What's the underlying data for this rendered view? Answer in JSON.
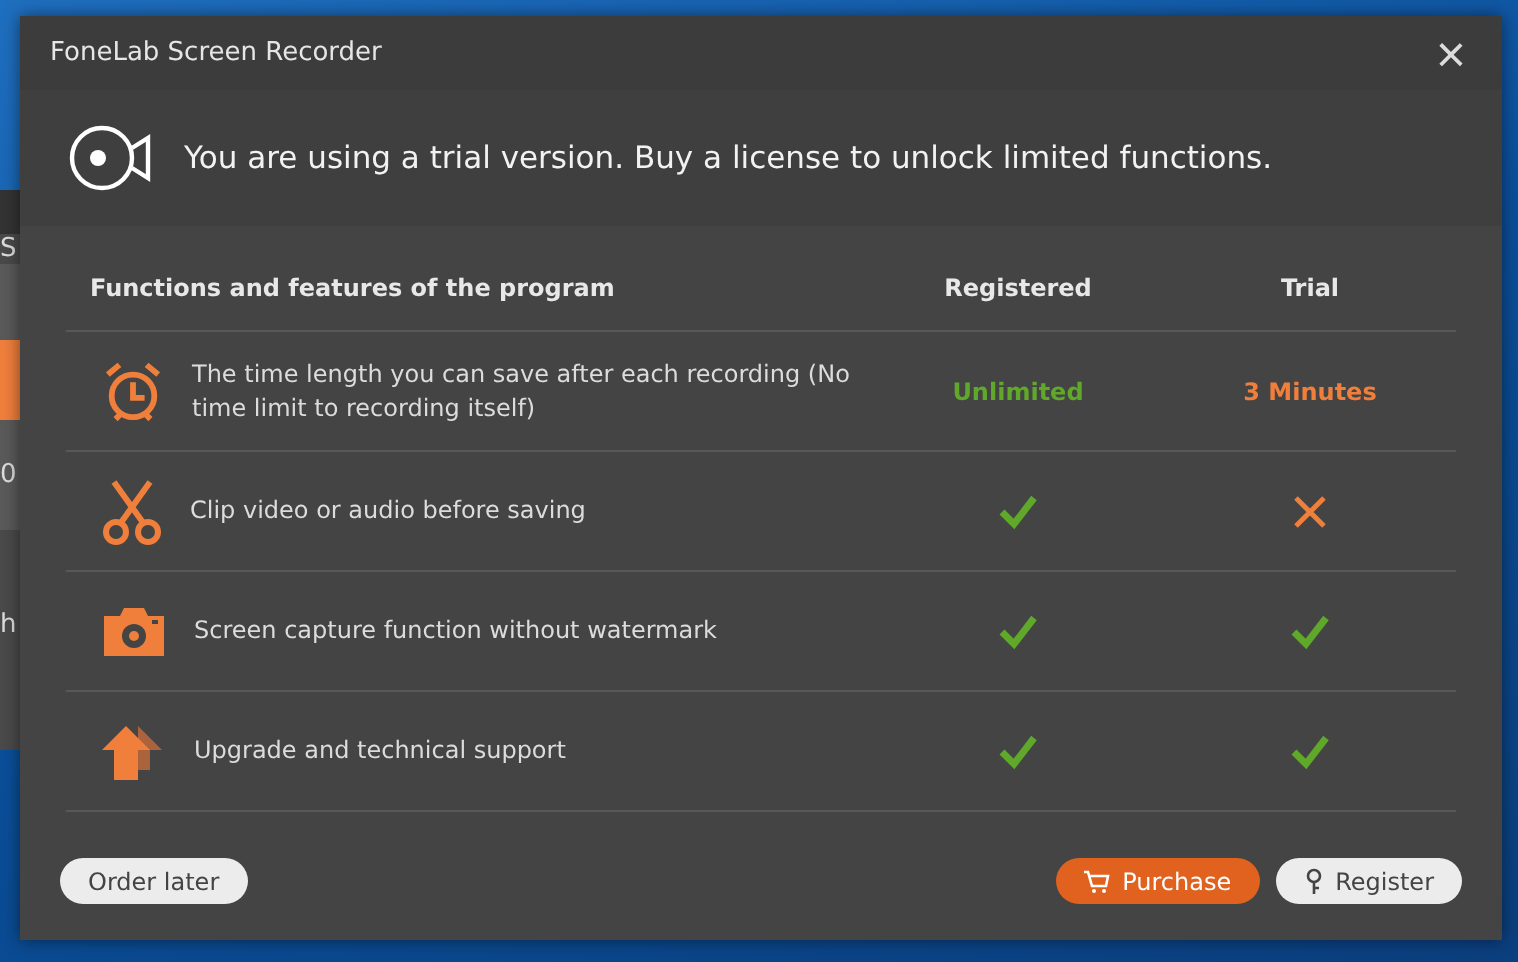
{
  "background_app": {
    "texts": [
      "S",
      "0",
      "h"
    ]
  },
  "window": {
    "title": "FoneLab Screen Recorder",
    "close": "×"
  },
  "banner": {
    "message": "You are using a trial version. Buy a license to unlock limited functions."
  },
  "table": {
    "columns": [
      "Functions and features of the program",
      "Registered",
      "Trial"
    ],
    "rows": [
      {
        "feature": "The time length you can save after each recording (No time limit to recording itself)",
        "registered": {
          "kind": "text",
          "text": "Unlimited",
          "color": "#5fa82a"
        },
        "trial": {
          "kind": "text",
          "text": "3 Minutes",
          "color": "#f07f3c"
        }
      },
      {
        "feature": "Clip video or audio before saving",
        "registered": {
          "kind": "check"
        },
        "trial": {
          "kind": "cross"
        }
      },
      {
        "feature": "Screen capture function without watermark",
        "registered": {
          "kind": "check"
        },
        "trial": {
          "kind": "check"
        }
      },
      {
        "feature": "Upgrade and technical support",
        "registered": {
          "kind": "check"
        },
        "trial": {
          "kind": "check"
        }
      }
    ]
  },
  "buttons": {
    "order_later": "Order later",
    "purchase": "Purchase",
    "register": "Register"
  }
}
